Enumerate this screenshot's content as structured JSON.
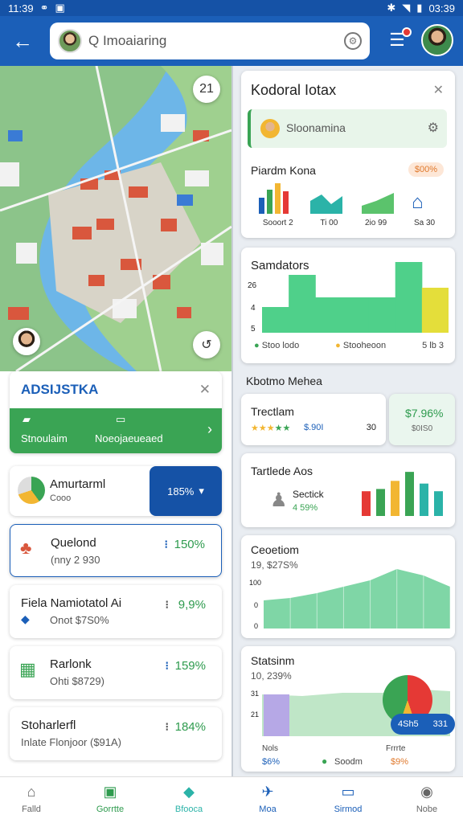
{
  "status": {
    "time_left": "11:39",
    "time_right": "03:39"
  },
  "search": {
    "placeholder": "Q Imoaiaring"
  },
  "map": {
    "top_btn": "21",
    "bottom_btn": "↺"
  },
  "right": {
    "card1": {
      "title": "Kodoral Iotax",
      "search": "Sloonamina",
      "section": "Piardm Kona",
      "badge": "$00%",
      "mini_labels": [
        "Sooort 2",
        "Ti 00",
        "2io 99",
        "Sa 30"
      ]
    },
    "card2": {
      "title": "Samdators",
      "y_ticks": [
        "26",
        "4",
        "5"
      ],
      "chart_values": [
        8,
        18,
        11,
        11,
        11,
        22,
        14
      ],
      "legend": [
        "Stoo lodo",
        "Stooheoon",
        "5 lb 3"
      ]
    },
    "section_title": "Kbotmo Mehea",
    "card3": {
      "title": "Trectlam",
      "sub": "$.90I",
      "count": "30",
      "price": "$7.96%",
      "price_sub": "$0IS0"
    },
    "card4": {
      "title": "Tartlede Aos",
      "sub1": "Sectick",
      "sub2": "4 59%",
      "bars": [
        0.55,
        0.6,
        0.78,
        0.98,
        0.72,
        0.55
      ]
    },
    "card5": {
      "title": "Ceoetiom",
      "sub": "19, $27S%",
      "y_ticks": [
        "100",
        "0",
        "0"
      ],
      "area_values": [
        35,
        38,
        44,
        52,
        60,
        74,
        66,
        52
      ]
    },
    "card6": {
      "title": "Statsinm",
      "sub": "10, 239%",
      "y_ticks": [
        "31",
        "21"
      ],
      "pill_left": "4Sh5",
      "pill_right": "331",
      "foot": [
        "Nols",
        "Frrrte"
      ],
      "foot_vals": [
        "$6%",
        "Soodm",
        "$9%"
      ]
    }
  },
  "left": {
    "ad": {
      "title": "ADSIJSTKA",
      "left": "Stnoulaim",
      "right": "Noeojaeueaed"
    },
    "amount": {
      "title": "Amurtarml",
      "sub": "Cooo",
      "badge": "185%"
    },
    "list": [
      {
        "title": "Quelond",
        "sub": "(nny 2 930",
        "pct": "150%"
      },
      {
        "title": "Fiela Namiotatol Ai",
        "sub": "Onot $7S0%",
        "pct": "9,9%"
      },
      {
        "title": "Rarlonk",
        "sub": "Ohti $8729)",
        "pct": "159%"
      },
      {
        "title": "Stoharlerfl",
        "sub": "Inlate Flonjoor ($91A)",
        "pct": "184%"
      }
    ]
  },
  "nav": [
    "Falld",
    "Gorrtte",
    "Bfooca",
    "Moa",
    "Sirmod",
    "Nobe"
  ]
}
